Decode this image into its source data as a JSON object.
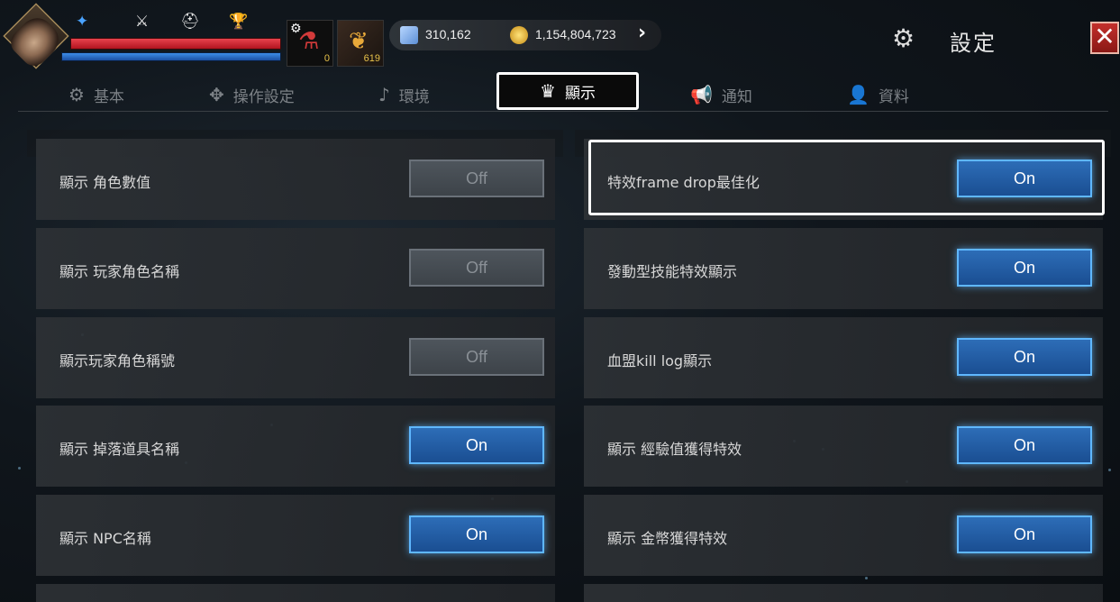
{
  "hud": {
    "potion_count": "0",
    "leaf_count": "619",
    "diamonds": "310,162",
    "gold": "1,154,804,723",
    "settings_title": "設定",
    "close_label": "✕"
  },
  "tabs": [
    {
      "label": "基本",
      "icon": "gear-icon"
    },
    {
      "label": "操作設定",
      "icon": "move-icon"
    },
    {
      "label": "環境",
      "icon": "music-note-icon"
    },
    {
      "label": "顯示",
      "icon": "display-icon",
      "active": true
    },
    {
      "label": "通知",
      "icon": "megaphone-icon"
    },
    {
      "label": "資料",
      "icon": "user-info-icon"
    }
  ],
  "left_rows": [
    {
      "label": "顯示 角色數值",
      "value": "Off"
    },
    {
      "label": "顯示 玩家角色名稱",
      "value": "Off"
    },
    {
      "label": "顯示玩家角色稱號",
      "value": "Off"
    },
    {
      "label": "顯示 掉落道具名稱",
      "value": "On"
    },
    {
      "label": "顯示 NPC名稱",
      "value": "On"
    }
  ],
  "right_rows": [
    {
      "label": "特效frame drop最佳化",
      "value": "On"
    },
    {
      "label": "發動型技能特效顯示",
      "value": "On"
    },
    {
      "label": "血盟kill log顯示",
      "value": "On"
    },
    {
      "label": "顯示 經驗值獲得特效",
      "value": "On"
    },
    {
      "label": "顯示 金幣獲得特效",
      "value": "On"
    }
  ],
  "colors": {
    "toggle_on": "#2d6db7",
    "toggle_off": "#4e555c",
    "hp": "#e9424d",
    "mp": "#3c8de8"
  }
}
